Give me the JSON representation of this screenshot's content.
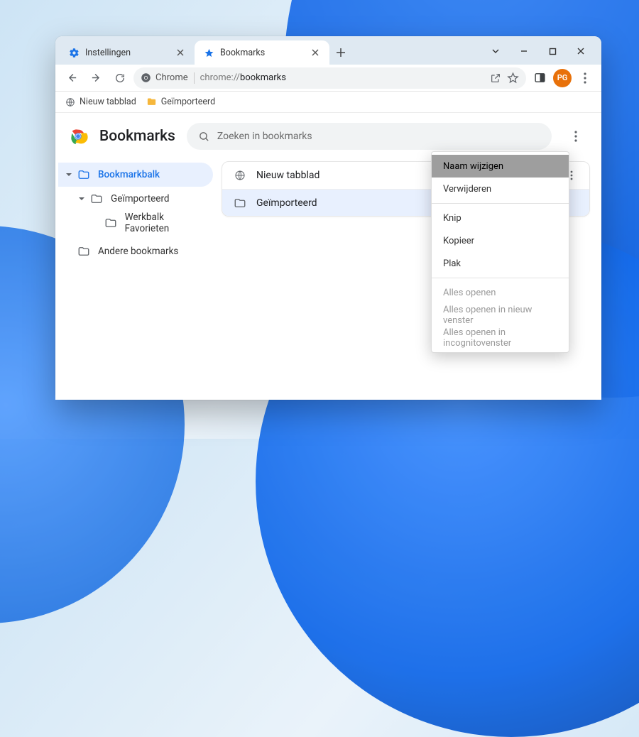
{
  "tabs": [
    {
      "title": "Instellingen",
      "favicon": "gear-blue",
      "active": false
    },
    {
      "title": "Bookmarks",
      "favicon": "star-blue",
      "active": true
    }
  ],
  "omnibox": {
    "origin_label": "Chrome",
    "url_prefix": "chrome://",
    "url_path": "bookmarks"
  },
  "profile": {
    "initials": "PG"
  },
  "bookmarks_bar": {
    "items": [
      {
        "label": "Nieuw tabblad",
        "icon": "globe-grey"
      },
      {
        "label": "Geïmporteerd",
        "icon": "folder-yellow"
      }
    ]
  },
  "page": {
    "title": "Bookmarks",
    "search_placeholder": "Zoeken in bookmarks"
  },
  "sidebar": {
    "items": [
      {
        "label": "Bookmarkbalk",
        "icon": "folder-blue",
        "depth": 0,
        "selected": true,
        "expandable": true,
        "expanded": true
      },
      {
        "label": "Geïmporteerd",
        "icon": "folder-grey",
        "depth": 1,
        "selected": false,
        "expandable": true,
        "expanded": true
      },
      {
        "label": "Werkbalk Favorieten",
        "icon": "folder-grey",
        "depth": 2,
        "selected": false,
        "expandable": false
      },
      {
        "label": "Andere bookmarks",
        "icon": "folder-grey",
        "depth": 0,
        "selected": false,
        "expandable": false
      }
    ]
  },
  "list": {
    "rows": [
      {
        "label": "Nieuw tabblad",
        "icon": "globe-grey",
        "selected": false,
        "has_more": true
      },
      {
        "label": "Geïmporteerd",
        "icon": "folder-blue",
        "selected": true,
        "has_more": false
      }
    ]
  },
  "context_menu": {
    "groups": [
      [
        {
          "label": "Naam wijzigen",
          "hover": true,
          "disabled": false
        },
        {
          "label": "Verwijderen",
          "hover": false,
          "disabled": false
        }
      ],
      [
        {
          "label": "Knip",
          "hover": false,
          "disabled": false
        },
        {
          "label": "Kopieer",
          "hover": false,
          "disabled": false
        },
        {
          "label": "Plak",
          "hover": false,
          "disabled": false
        }
      ],
      [
        {
          "label": "Alles openen",
          "hover": false,
          "disabled": true
        },
        {
          "label": "Alles openen in nieuw venster",
          "hover": false,
          "disabled": true
        },
        {
          "label": "Alles openen in incognitovenster",
          "hover": false,
          "disabled": true
        }
      ]
    ]
  }
}
